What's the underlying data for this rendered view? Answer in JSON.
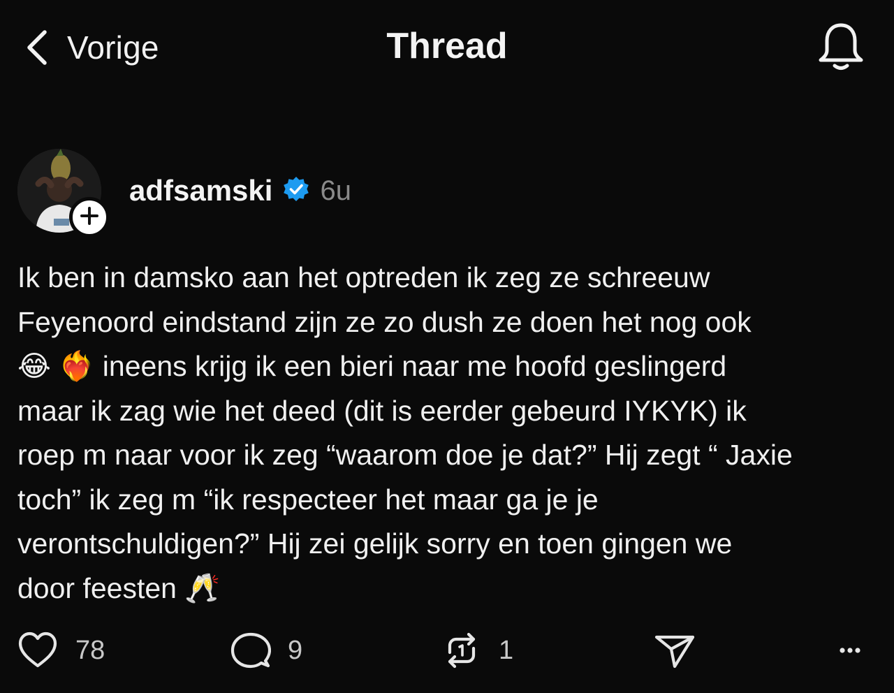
{
  "header": {
    "back_label": "Vorige",
    "title": "Thread",
    "back_icon": "chevron-left-icon",
    "notification_icon": "bell-icon"
  },
  "post": {
    "author": {
      "username": "adfsamski",
      "verified": true,
      "verified_color": "#1d9bf0",
      "follow_icon": "plus-icon"
    },
    "timestamp": "6u",
    "text_lines": [
      "Ik ben in damsko aan het optreden ik zeg ze schreeuw",
      "Feyenoord eindstand zijn ze zo dush ze doen het nog ook",
      "ineens krijg ik een bieri naar me hoofd geslingerd",
      "maar ik zag wie het deed (dit is eerder gebeurd IYKYK) ik",
      "roep m naar voor ik zeg “waarom doe je dat?” Hij zegt “ Jaxie",
      "toch” ik zeg m “ik respecteer het maar ga je je",
      "verontschuldigen?” Hij zei gelijk sorry en toen gingen we",
      "door feesten"
    ],
    "emojis": {
      "laughing": "😂",
      "heart_on_fire": "❤️‍🔥",
      "champagne": "🥂"
    },
    "actions": {
      "likes": "78",
      "replies": "9",
      "reposts": "1",
      "like_icon": "heart-icon",
      "reply_icon": "comment-icon",
      "repost_icon": "repost-icon",
      "share_icon": "send-icon",
      "more_icon": "more-icon"
    }
  },
  "colors": {
    "background": "#0a0a0a",
    "text": "#f2f2f2",
    "muted": "#8a8a8a",
    "verified": "#1d9bf0"
  }
}
